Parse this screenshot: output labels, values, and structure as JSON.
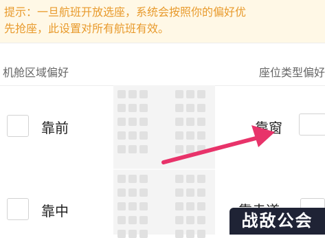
{
  "notice": {
    "text": "提示：一旦航班开放选座，系统会按照你的偏好优\n先抢座，此设置对所有航班有效。"
  },
  "sections": {
    "cabin_area_title": "机舱区域偏好",
    "seat_type_title": "座位类型偏好"
  },
  "cabin_options": [
    {
      "label": "靠前",
      "checked": false
    },
    {
      "label": "靠中",
      "checked": false
    }
  ],
  "seat_type_options": [
    {
      "label": "靠窗",
      "checked": false
    },
    {
      "label": "靠走道",
      "checked": false
    }
  ],
  "watermark": {
    "text": "战敌公会"
  },
  "colors": {
    "notice_bg": "#fff8e6",
    "notice_text": "#e89a2c",
    "arrow": "#e8336a"
  },
  "icons": {
    "arrow": "pink-arrow-icon"
  }
}
